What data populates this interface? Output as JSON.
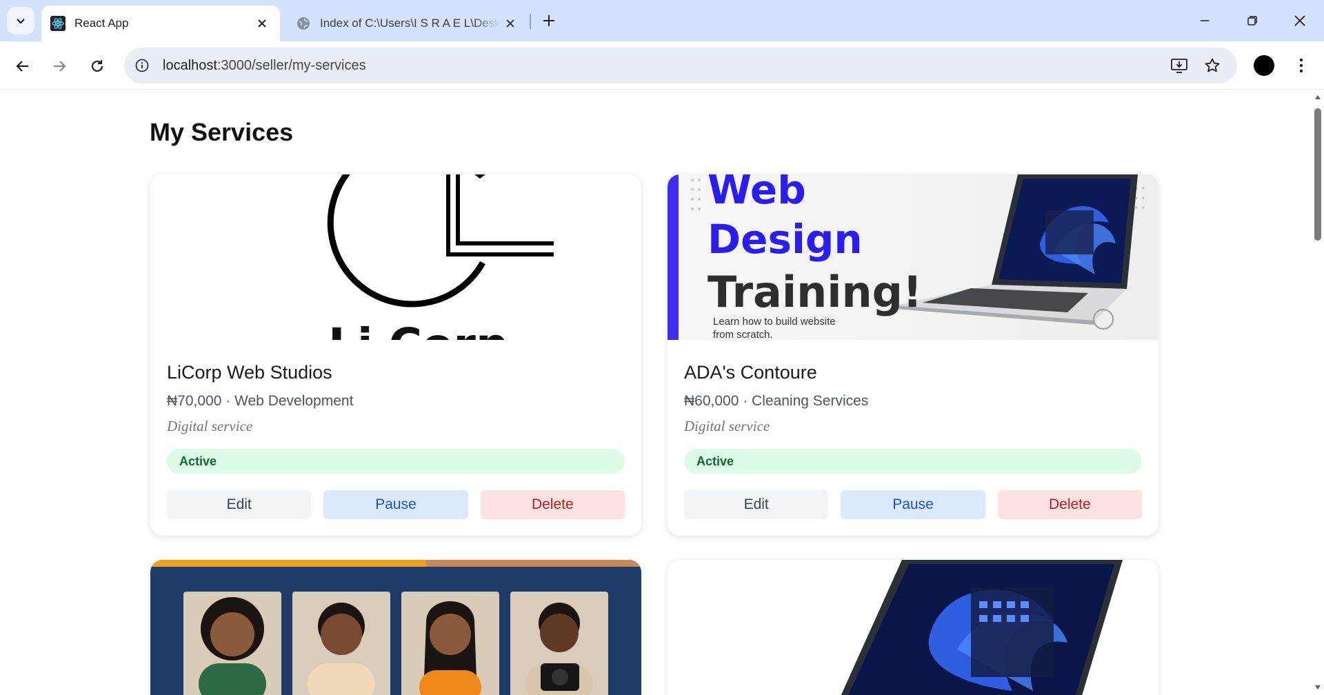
{
  "browser": {
    "tabs": [
      {
        "title": "React App",
        "active": true
      },
      {
        "title": "Index of C:\\Users\\I S R A E L\\Desktop",
        "active": false
      }
    ],
    "url_host": "localhost",
    "url_path": ":3000/seller/my-services"
  },
  "page": {
    "title": "My Services"
  },
  "services": [
    {
      "name": "LiCorp Web Studios",
      "meta": "₦70,000 · Web Development",
      "type": "Digital service",
      "status": "Active",
      "image_text": "LiCorp"
    },
    {
      "name": "ADA's Contoure",
      "meta": "₦60,000 · Cleaning Services",
      "type": "Digital service",
      "status": "Active",
      "image_lines": [
        "Web",
        "Design",
        "Training!"
      ],
      "image_sub": [
        "Learn how to build website",
        "from scratch."
      ]
    }
  ],
  "buttons": {
    "edit": "Edit",
    "pause": "Pause",
    "delete": "Delete"
  },
  "colors": {
    "status_bg": "#dcfce7",
    "status_text": "#166534",
    "pause_bg": "#dbeafe",
    "delete_bg": "#fee2e2",
    "ada_accent": "#3b2cf0"
  }
}
